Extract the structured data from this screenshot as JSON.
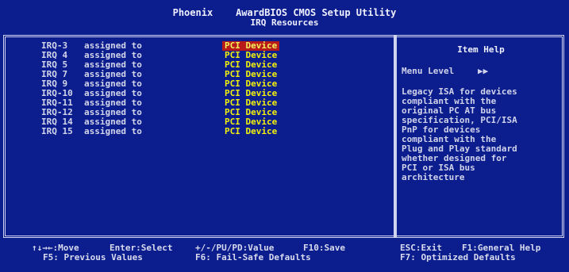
{
  "header": {
    "line1": "Phoenix    AwardBIOS CMOS Setup Utility",
    "line2": "IRQ Resources"
  },
  "settings": [
    {
      "label": "IRQ-3",
      "assign": "assigned to",
      "value": "PCI Device",
      "selected": true
    },
    {
      "label": "IRQ 4",
      "assign": "assigned to",
      "value": "PCI Device",
      "selected": false
    },
    {
      "label": "IRQ 5",
      "assign": "assigned to",
      "value": "PCI Device",
      "selected": false
    },
    {
      "label": "IRQ 7",
      "assign": "assigned to",
      "value": "PCI Device",
      "selected": false
    },
    {
      "label": "IRQ 9",
      "assign": "assigned to",
      "value": "PCI Device",
      "selected": false
    },
    {
      "label": "IRQ-10",
      "assign": "assigned to",
      "value": "PCI Device",
      "selected": false
    },
    {
      "label": "IRQ-11",
      "assign": "assigned to",
      "value": "PCI Device",
      "selected": false
    },
    {
      "label": "IRQ-12",
      "assign": "assigned to",
      "value": "PCI Device",
      "selected": false
    },
    {
      "label": "IRQ 14",
      "assign": "assigned to",
      "value": "PCI Device",
      "selected": false
    },
    {
      "label": "IRQ 15",
      "assign": "assigned to",
      "value": "PCI Device",
      "selected": false
    }
  ],
  "help": {
    "title": "Item Help",
    "menu_level_label": "Menu Level",
    "menu_level_value": "▶▶",
    "text": "Legacy ISA for devices\ncompliant with the\noriginal PC AT bus\nspecification, PCI/ISA\nPnP for devices\ncompliant with the\nPlug and Play standard\nwhether designed for\nPCI or ISA bus\narchitecture"
  },
  "footer": {
    "move": "↑↓→←:Move",
    "select": "Enter:Select",
    "value": "+/-/PU/PD:Value",
    "save": "F10:Save",
    "exit": "ESC:Exit",
    "help": "F1:General Help",
    "prev": "F5: Previous Values",
    "failsafe": "F6: Fail-Safe Defaults",
    "optimized": "F7: Optimized Defaults"
  },
  "colors": {
    "background": "#0c1d8e",
    "value_text": "#f4f20a",
    "highlight": "#b81a1a"
  }
}
